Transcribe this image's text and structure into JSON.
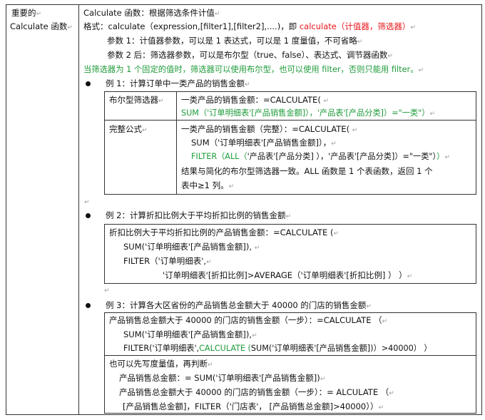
{
  "left_label_line1": "重要的",
  "left_label_line2": "Calculate 函数",
  "para_mark": "↵",
  "intro": {
    "line1": "Calculate 函数：根据筛选条件计值",
    "format_label": "格式：calculate（expression,[filter1],[filter2],....)，即 ",
    "format_red": "calculate（计值器，筛选器）",
    "param1": "参数 1：计值器参数，可以是 1 表达式，可以是 1 度量值，不可省略",
    "param2": "参数 2 后：筛选器参数，可以是布尔型（true、false）、表达式、调节器函数",
    "green_note": "当筛选器为 1 个固定的值时，筛选器可以使用布尔型，也可以使用 filter，否则只能用 filter。"
  },
  "example1": {
    "title": "例 1：计算订单中一类产品的销售金额",
    "row1_label": "布尔型筛选器",
    "row1_line1": "一类产品的销售金额：=CALCULATE(",
    "row1_line2_green": "SUM（'订单明细表'[产品销售金额]），'产品表'[产品分类]）=\"一类\"）",
    "row2_label": "完整公式",
    "row2_line1": "一类产品的销售金额（完整）：=CALCULATE(",
    "row2_line2": "SUM（'订单明细表'[产品销售金额]），",
    "row2_line3_green_a": "FILTER（ALL（",
    "row2_line3_black_b": "'产品表'[产品分类]  ），'产品表'[产品分类]）=\"一类\"）",
    "row2_line3_green_c": "）",
    "row2_line4": "结果与简化的布尔型筛选器一致。ALL 函数是 1 个表函数，返回 1 个",
    "row2_line5": "表中≥1 列。"
  },
  "example2": {
    "title": "例 2：计算折扣比例大于平均折扣比例的销售金额",
    "line1": "折扣比例大于平均折扣比例的产品销售金额：=CALCULATE (",
    "line2": "SUM('订单明细表'[产品销售金额]),",
    "line3": "FILTER（'订单明细表',",
    "line4": "'订单明细表'[折扣比例]>AVERAGE（'订单明细表'[折扣比例]  ）  ）"
  },
  "example3": {
    "title": "例 3：计算各大区省份的产品销售总金额大于 40000 的门店的销售金额",
    "box1_line1": "产品销售总金额大于 40000 的门店的销售金额（一步）：=CALCULATE  （",
    "box1_line2": "SUM('订单明细表'[产品销售金额]),",
    "box1_line3_a": "FILTER('订单明细表',",
    "box1_line3_green": "CALCULATE (",
    "box1_line3_b": "SUM('订单明细表'[产品销售金额])）>40000）  ）",
    "box2_line1": "也可以先写度量值，再判断",
    "box2_line2": "产品销售总金额：= SUM('订单明细表'[产品销售金额])",
    "box2_line3": "产品销售总金额大于 40000 的门店的销售金额（一步）：= ALCULATE  （",
    "box2_line4": "[产品销售总金额]，FILTER（'门店表'，  [产品销售总金额]>40000））"
  }
}
